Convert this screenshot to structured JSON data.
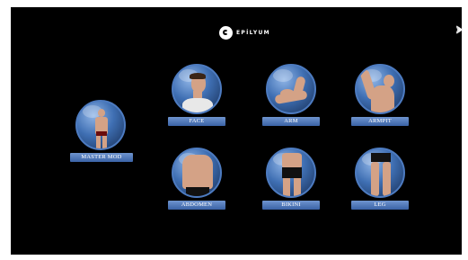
{
  "brand": {
    "name": "EPİLYUM"
  },
  "menu": {
    "master": "MASTER MOD",
    "face": "FACE",
    "arm": "ARM",
    "armpit": "ARMPIT",
    "abdomen": "ABDOMEN",
    "bikini": "BIKINI",
    "leg": "LEG"
  },
  "colors": {
    "background": "#000000",
    "accent": "#3a62a6",
    "ring": "#4d7bc0"
  },
  "icons": {
    "next": "chevron-right-icon",
    "logo": "epilyum-logo-icon"
  }
}
